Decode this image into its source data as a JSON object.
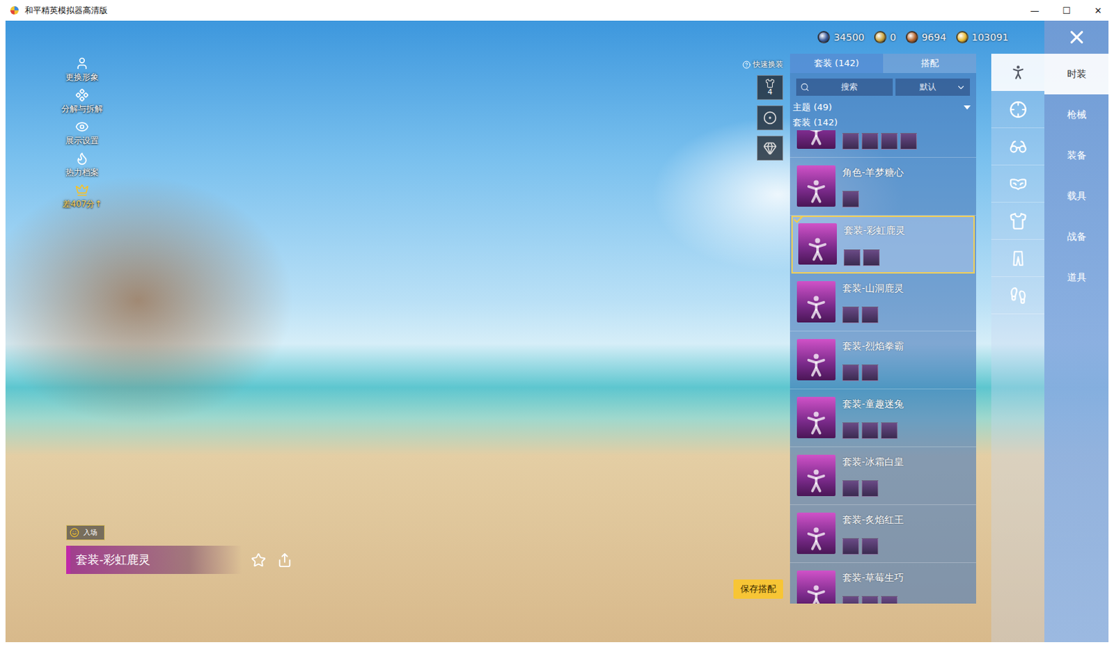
{
  "window": {
    "title": "和平精英模拟器高清版",
    "controls": [
      "—",
      "☐",
      "✕"
    ]
  },
  "side_menu": [
    {
      "label": "更换形象"
    },
    {
      "label": "分解与拆解"
    },
    {
      "label": "展示设置"
    },
    {
      "label": "热力档案"
    },
    {
      "label": "差407分↑"
    }
  ],
  "currencies": [
    {
      "amount": "34500",
      "color": "#3a5a9a"
    },
    {
      "amount": "0",
      "color": "#c9a23a"
    },
    {
      "amount": "9694",
      "color": "#b5652d"
    },
    {
      "amount": "103091",
      "color": "#e8b830"
    }
  ],
  "quick_switch": {
    "label": "快速换装",
    "slots": [
      {
        "badge": "4"
      },
      {
        "badge": ""
      },
      {
        "badge": ""
      }
    ]
  },
  "list_panel": {
    "tabs": [
      {
        "label": "套装 (142)",
        "selected": true
      },
      {
        "label": "搭配",
        "selected": false
      }
    ],
    "search": {
      "placeholder": "搜索"
    },
    "sort": {
      "value": "默认"
    },
    "theme_group": {
      "label": "主题 (49)",
      "expanded": false
    },
    "suit_group": {
      "label": "套装 (142)"
    },
    "items": [
      {
        "parts": 4,
        "selected": false
      },
      {
        "name": "角色-羊梦糖心",
        "parts": 1,
        "selected": false
      },
      {
        "name": "套装-彩虹鹿灵",
        "parts": 2,
        "selected": true
      },
      {
        "name": "套装-山洞鹿灵",
        "parts": 2,
        "selected": false
      },
      {
        "name": "套装-烈焰拳霸",
        "parts": 2,
        "selected": false
      },
      {
        "name": "套装-童趣迷兔",
        "parts": 3,
        "selected": false
      },
      {
        "name": "套装-冰霜白皇",
        "parts": 2,
        "selected": false
      },
      {
        "name": "套装-炙焰红王",
        "parts": 2,
        "selected": false
      },
      {
        "name": "套装-草莓生巧",
        "parts": 3,
        "selected": false
      }
    ]
  },
  "icon_tabs": [
    {
      "selected": true
    },
    {
      "selected": false
    },
    {
      "selected": false
    },
    {
      "selected": false
    },
    {
      "selected": false
    },
    {
      "selected": false
    },
    {
      "selected": false
    }
  ],
  "categories": [
    {
      "label": "时装",
      "selected": true
    },
    {
      "label": "枪械",
      "selected": false
    },
    {
      "label": "装备",
      "selected": false
    },
    {
      "label": "载具",
      "selected": false
    },
    {
      "label": "战备",
      "selected": false
    },
    {
      "label": "道具",
      "selected": false
    }
  ],
  "entrance_badge": {
    "label": "入场"
  },
  "outfit_name": "套装-彩虹鹿灵",
  "save_button": {
    "label": "保存搭配"
  }
}
